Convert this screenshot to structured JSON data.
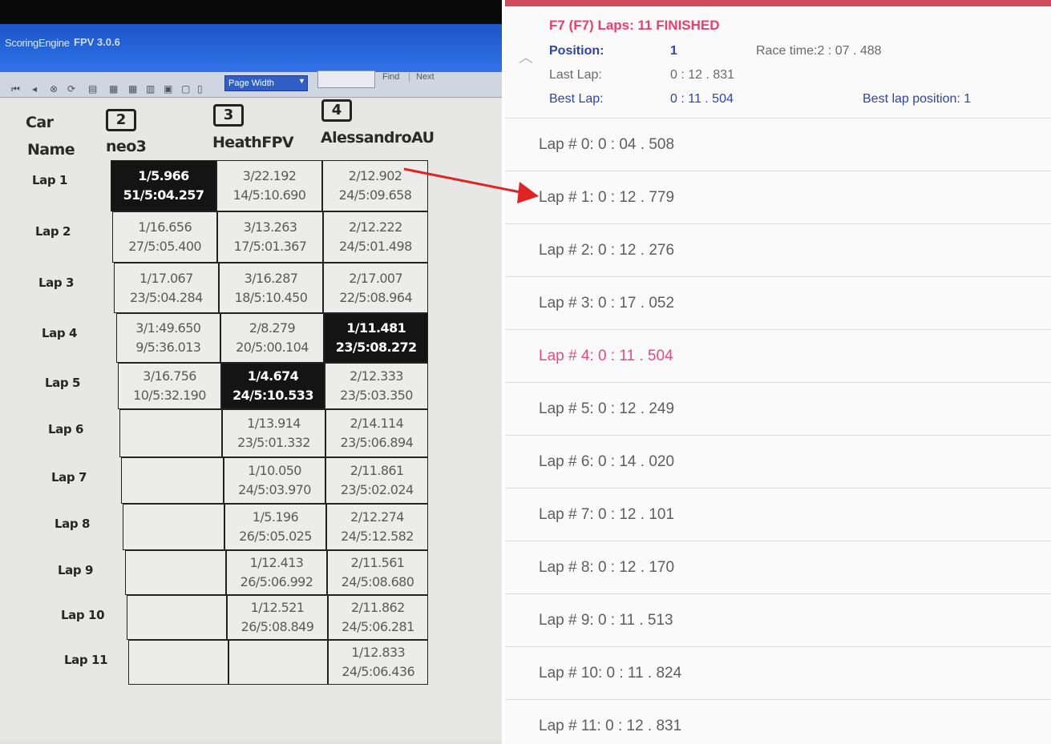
{
  "photo": {
    "app_title": "ScoringEngine",
    "app_version": "FPV 3.0.6",
    "toolbar": {
      "zoom_value": "Page Width",
      "find_label": "Find",
      "separator": "|",
      "next_label": "Next"
    },
    "header_car": "Car",
    "header_name": "Name",
    "cars": [
      {
        "number": "2",
        "name": "neo3"
      },
      {
        "number": "3",
        "name": "HeathFPV"
      },
      {
        "number": "4",
        "name": "AlessandroAU"
      }
    ],
    "laps": [
      {
        "label": "Lap 1",
        "cells": [
          {
            "top": "1/5.966",
            "bottom": "51/5:04.257",
            "highlight": true
          },
          {
            "top": "3/22.192",
            "bottom": "14/5:10.690",
            "highlight": false
          },
          {
            "top": "2/12.902",
            "bottom": "24/5:09.658",
            "highlight": false
          }
        ]
      },
      {
        "label": "Lap 2",
        "cells": [
          {
            "top": "1/16.656",
            "bottom": "27/5:05.400",
            "highlight": false
          },
          {
            "top": "3/13.263",
            "bottom": "17/5:01.367",
            "highlight": false
          },
          {
            "top": "2/12.222",
            "bottom": "24/5:01.498",
            "highlight": false
          }
        ]
      },
      {
        "label": "Lap 3",
        "cells": [
          {
            "top": "1/17.067",
            "bottom": "23/5:04.284",
            "highlight": false
          },
          {
            "top": "3/16.287",
            "bottom": "18/5:10.450",
            "highlight": false
          },
          {
            "top": "2/17.007",
            "bottom": "22/5:08.964",
            "highlight": false
          }
        ]
      },
      {
        "label": "Lap 4",
        "cells": [
          {
            "top": "3/1:49.650",
            "bottom": "9/5:36.013",
            "highlight": false
          },
          {
            "top": "2/8.279",
            "bottom": "20/5:00.104",
            "highlight": false
          },
          {
            "top": "1/11.481",
            "bottom": "23/5:08.272",
            "highlight": true
          }
        ]
      },
      {
        "label": "Lap 5",
        "cells": [
          {
            "top": "3/16.756",
            "bottom": "10/5:32.190",
            "highlight": false
          },
          {
            "top": "1/4.674",
            "bottom": "24/5:10.533",
            "highlight": true
          },
          {
            "top": "2/12.333",
            "bottom": "23/5:03.350",
            "highlight": false
          }
        ]
      },
      {
        "label": "Lap 6",
        "cells": [
          null,
          {
            "top": "1/13.914",
            "bottom": "23/5:01.332",
            "highlight": false
          },
          {
            "top": "2/14.114",
            "bottom": "23/5:06.894",
            "highlight": false
          }
        ]
      },
      {
        "label": "Lap 7",
        "cells": [
          null,
          {
            "top": "1/10.050",
            "bottom": "24/5:03.970",
            "highlight": false
          },
          {
            "top": "2/11.861",
            "bottom": "23/5:02.024",
            "highlight": false
          }
        ]
      },
      {
        "label": "Lap 8",
        "cells": [
          null,
          {
            "top": "1/5.196",
            "bottom": "26/5:05.025",
            "highlight": false
          },
          {
            "top": "2/12.274",
            "bottom": "24/5:12.582",
            "highlight": false
          }
        ]
      },
      {
        "label": "Lap 9",
        "cells": [
          null,
          {
            "top": "1/12.413",
            "bottom": "26/5:06.992",
            "highlight": false
          },
          {
            "top": "2/11.561",
            "bottom": "24/5:08.680",
            "highlight": false
          }
        ]
      },
      {
        "label": "Lap 10",
        "cells": [
          null,
          {
            "top": "1/12.521",
            "bottom": "26/5:08.849",
            "highlight": false
          },
          {
            "top": "2/11.862",
            "bottom": "24/5:06.281",
            "highlight": false
          }
        ]
      },
      {
        "label": "Lap 11",
        "cells": [
          null,
          null,
          {
            "top": "1/12.833",
            "bottom": "24/5:06.436",
            "highlight": false
          }
        ]
      }
    ]
  },
  "panel": {
    "accent_color": "#cf4b5b",
    "race_header": "F7 (F7) Laps: 11 FINISHED",
    "collapse_icon": "chevron-up-icon",
    "position_label": "Position:",
    "position_value": "1",
    "race_time": "Race time:2 : 07 . 488",
    "last_lap_label": "Last Lap:",
    "last_lap_value": "0 : 12 . 831",
    "best_lap_label": "Best Lap:",
    "best_lap_value": "0 : 11 . 504",
    "best_lap_position": "Best lap position: 1",
    "laps": [
      {
        "text": "Lap # 0: 0 : 04 . 508",
        "best": false
      },
      {
        "text": "Lap # 1: 0 : 12 . 779",
        "best": false
      },
      {
        "text": "Lap # 2: 0 : 12 . 276",
        "best": false
      },
      {
        "text": "Lap # 3: 0 : 17 . 052",
        "best": false
      },
      {
        "text": "Lap # 4: 0 : 11 . 504",
        "best": true
      },
      {
        "text": "Lap # 5: 0 : 12 . 249",
        "best": false
      },
      {
        "text": "Lap # 6: 0 : 14 . 020",
        "best": false
      },
      {
        "text": "Lap # 7: 0 : 12 . 101",
        "best": false
      },
      {
        "text": "Lap # 8: 0 : 12 . 170",
        "best": false
      },
      {
        "text": "Lap # 9: 0 : 11 . 513",
        "best": false
      },
      {
        "text": "Lap # 10: 0 : 11 . 824",
        "best": false
      },
      {
        "text": "Lap # 11: 0 : 12 . 831",
        "best": false
      }
    ]
  },
  "annotation": {
    "arrow_color": "#e02424"
  }
}
